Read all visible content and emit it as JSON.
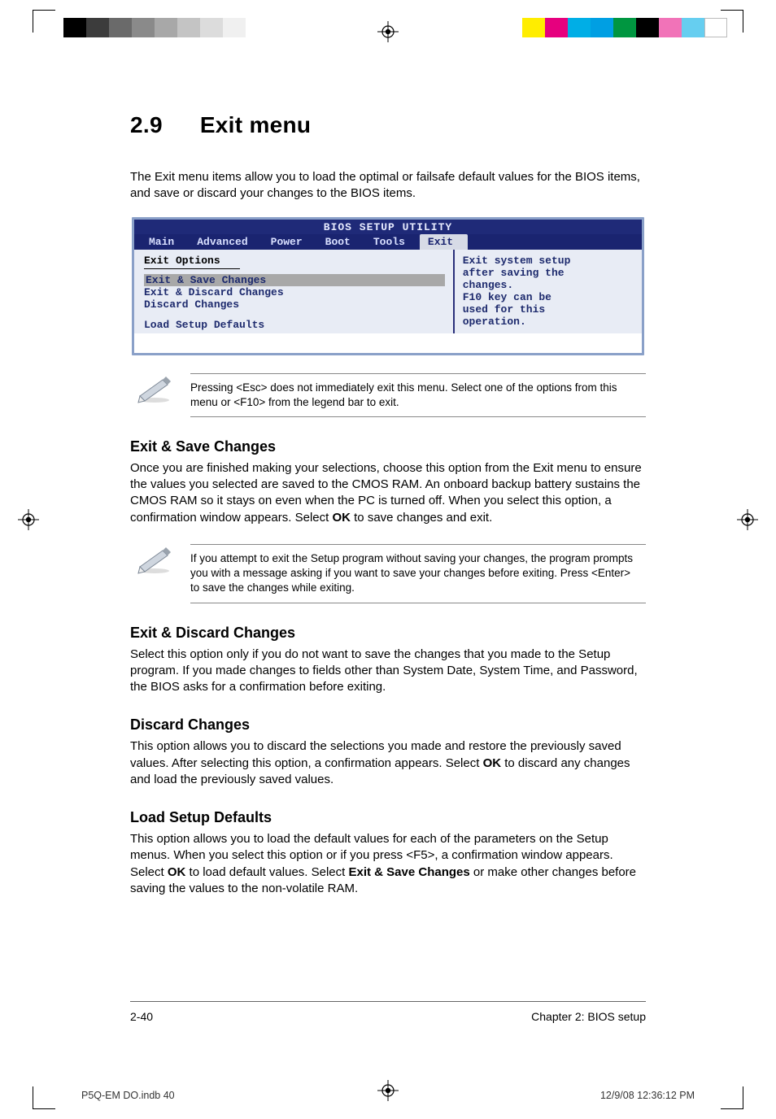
{
  "section": {
    "number": "2.9",
    "title": "Exit menu"
  },
  "intro": "The Exit menu items allow you to load the optimal or failsafe default values for the BIOS items, and save or discard your changes to the BIOS items.",
  "bios": {
    "title": "BIOS SETUP UTILITY",
    "tabs": [
      "Main",
      "Advanced",
      "Power",
      "Boot",
      "Tools",
      "Exit"
    ],
    "active_tab": "Exit",
    "options_header": "Exit Options",
    "options": [
      "Exit & Save Changes",
      "Exit & Discard Changes",
      "Discard Changes",
      "Load Setup Defaults"
    ],
    "selected_option": "Exit & Save Changes",
    "help_lines": [
      "Exit system setup",
      "after saving the",
      "changes.",
      "",
      "F10 key can be",
      "used for this",
      "operation."
    ]
  },
  "note1": "Pressing <Esc> does not immediately exit this menu. Select one of the options from this menu or <F10> from the legend bar to exit.",
  "sub1": {
    "title": "Exit & Save Changes",
    "text_before": "Once you are finished making your selections, choose this option from the Exit menu to ensure the values you selected are saved to the CMOS RAM. An onboard backup battery sustains the CMOS RAM so it stays on even when the PC is turned off. When you select this option, a confirmation window appears. Select ",
    "bold1": "OK",
    "text_after": " to save changes and exit."
  },
  "note2": "If you attempt to exit the Setup program without saving your changes, the program prompts you with a message asking if you want to save your changes before exiting. Press <Enter> to save the  changes while exiting.",
  "sub2": {
    "title": "Exit & Discard Changes",
    "text": "Select this option only if you do not want to save the changes that you  made to the Setup program. If you made changes to fields other than System Date, System Time, and Password, the BIOS asks for a confirmation before exiting."
  },
  "sub3": {
    "title": "Discard Changes",
    "text_before": "This option allows you to discard the selections you made and restore the previously saved values. After selecting this option, a confirmation appears. Select ",
    "bold1": "OK",
    "text_after": " to discard any changes and load the previously saved values."
  },
  "sub4": {
    "title": "Load Setup Defaults",
    "t1": "This option allows you to load the default values for each of the parameters on the Setup menus. When you select this option or if you press <F5>, a confirmation window appears. Select ",
    "b1": "OK",
    "t2": " to load default values. Select ",
    "b2": "Exit & Save Changes",
    "t3": " or make other changes before saving the values to the non-volatile RAM."
  },
  "footer": {
    "page": "2-40",
    "chapter": "Chapter 2: BIOS setup"
  },
  "slug": {
    "file": "P5Q-EM DO.indb   40",
    "date": "12/9/08   12:36:12 PM"
  }
}
